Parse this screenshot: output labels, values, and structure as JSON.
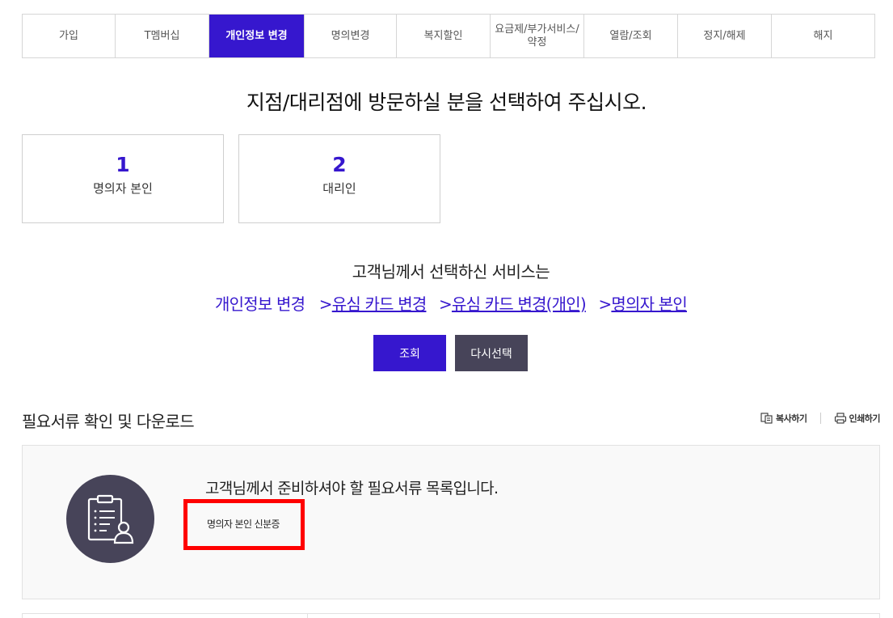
{
  "tabs": [
    {
      "label": "가입",
      "active": false
    },
    {
      "label": "T멤버십",
      "active": false
    },
    {
      "label": "개인정보 변경",
      "active": true
    },
    {
      "label": "명의변경",
      "active": false
    },
    {
      "label": "복지할인",
      "active": false
    },
    {
      "label": "요금제/부가서비스/약정",
      "active": false
    },
    {
      "label": "열람/조회",
      "active": false
    },
    {
      "label": "정지/해제",
      "active": false
    },
    {
      "label": "해지",
      "active": false
    }
  ],
  "heading": "지점/대리점에 방문하실 분을 선택하여 주십시오.",
  "choices": [
    {
      "number": "1",
      "label": "명의자 본인"
    },
    {
      "number": "2",
      "label": "대리인"
    }
  ],
  "selected": {
    "title": "고객님께서 선택하신 서비스는",
    "path": [
      "개인정보 변경",
      "유심 카드 변경",
      "유심 카드 변경(개인)",
      "명의자 본인"
    ],
    "separator": ">"
  },
  "buttons": {
    "search": "조회",
    "reset": "다시선택"
  },
  "section": {
    "title": "필요서류 확인 및 다운로드",
    "copy_label": "복사하기",
    "print_label": "인쇄하기"
  },
  "documents": {
    "title": "고객님께서 준비하셔야 할 필요서류 목록입니다.",
    "items": [
      "명의자 본인 신분증"
    ],
    "icon": "clipboard-user-icon"
  },
  "colors": {
    "accent": "#3617ce",
    "dark": "#474459",
    "highlight": "#ff0000"
  }
}
